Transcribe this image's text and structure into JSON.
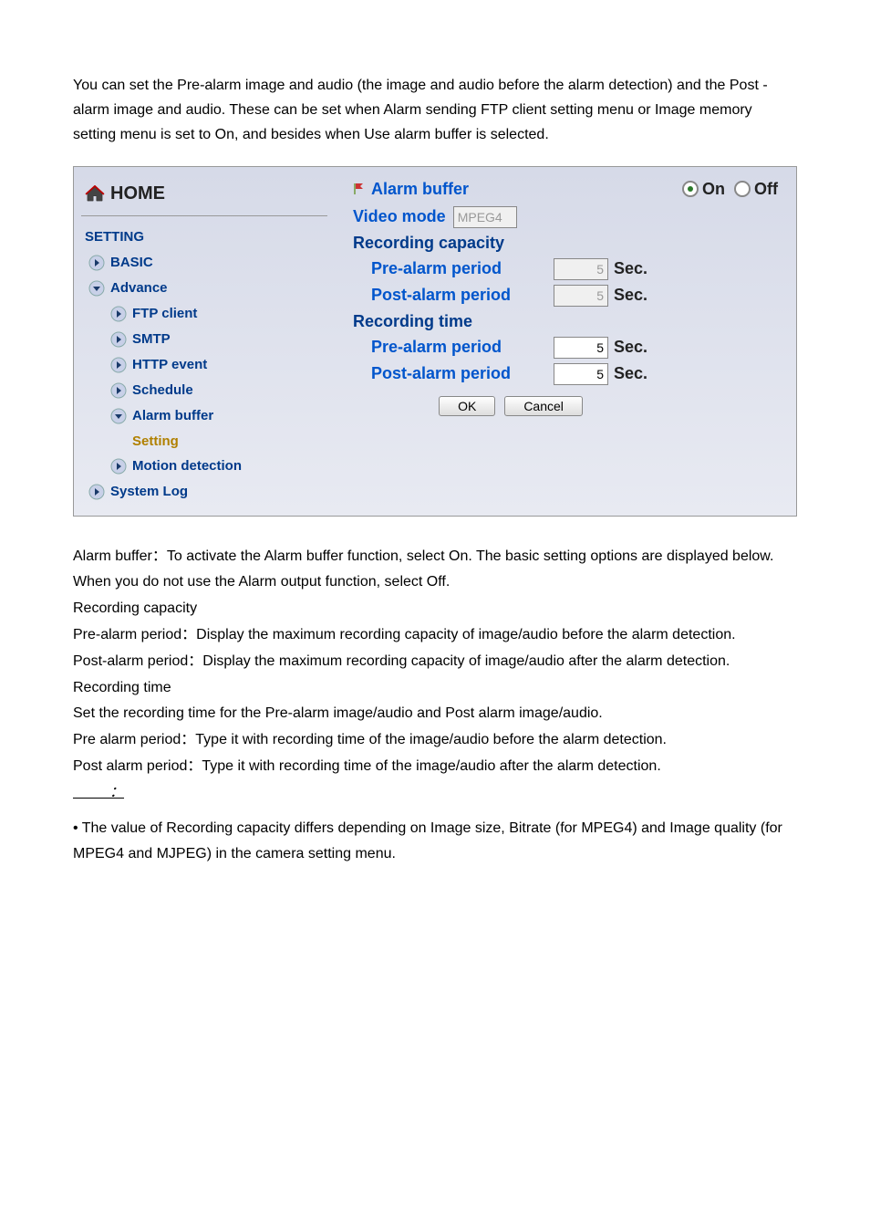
{
  "intro": "You can set the Pre-alarm image and audio (the image and audio before the alarm detection) and the Post - alarm image and audio. These can be set when Alarm sending FTP client setting menu or Image memory setting menu is set to On, and besides when Use alarm buffer is selected.",
  "sidebar": {
    "home": "HOME",
    "setting": "SETTING",
    "items": [
      {
        "label": "BASIC",
        "level": 1,
        "color": "blue",
        "active": false
      },
      {
        "label": "Advance",
        "level": 1,
        "color": "blue",
        "active": true
      },
      {
        "label": "FTP client",
        "level": 2,
        "color": "blue",
        "active": false
      },
      {
        "label": "SMTP",
        "level": 2,
        "color": "blue",
        "active": false
      },
      {
        "label": "HTTP event",
        "level": 2,
        "color": "blue",
        "active": false
      },
      {
        "label": "Schedule",
        "level": 2,
        "color": "blue",
        "active": false
      },
      {
        "label": "Alarm buffer",
        "level": 2,
        "color": "blue",
        "active": true
      },
      {
        "label": "Setting",
        "level": 3,
        "color": "yellow",
        "active": false,
        "noBullet": true
      },
      {
        "label": "Motion detection",
        "level": 2,
        "color": "blue",
        "active": false
      },
      {
        "label": "System Log",
        "level": 1,
        "color": "blue",
        "active": false
      }
    ]
  },
  "panel": {
    "title": "Alarm buffer",
    "onLabel": "On",
    "offLabel": "Off",
    "videoModeLabel": "Video mode",
    "videoModeValue": "MPEG4",
    "recCapacity": "Recording capacity",
    "recTime": "Recording time",
    "preAlarmLabel": "Pre-alarm period",
    "postAlarmLabel": "Post-alarm period",
    "capPre": "5",
    "capPost": "5",
    "timePre": "5",
    "timePost": "5",
    "sec": "Sec.",
    "ok": "OK",
    "cancel": "Cancel"
  },
  "body": {
    "p1": "Alarm buffer：To activate the Alarm buffer function, select On. The basic setting options are displayed below. When you do not use the Alarm output function, select Off.",
    "p2": "Recording capacity",
    "p3": "Pre-alarm period：Display the maximum recording capacity of image/audio before the alarm detection.",
    "p4": "Post-alarm period：Display the maximum recording capacity of image/audio after the alarm detection.",
    "p5": "Recording time",
    "p6": "Set the recording time for the Pre-alarm image/audio and Post alarm image/audio.",
    "p7": "Pre alarm period：Type it with recording time of the image/audio before the alarm detection.",
    "p8": "Post alarm period：Type it with recording time of the image/audio after the alarm detection.",
    "note": "         ：",
    "p9": "• The value of Recording capacity differs depending on Image size, Bitrate (for MPEG4) and Image quality (for MPEG4 and MJPEG) in the camera setting menu."
  }
}
